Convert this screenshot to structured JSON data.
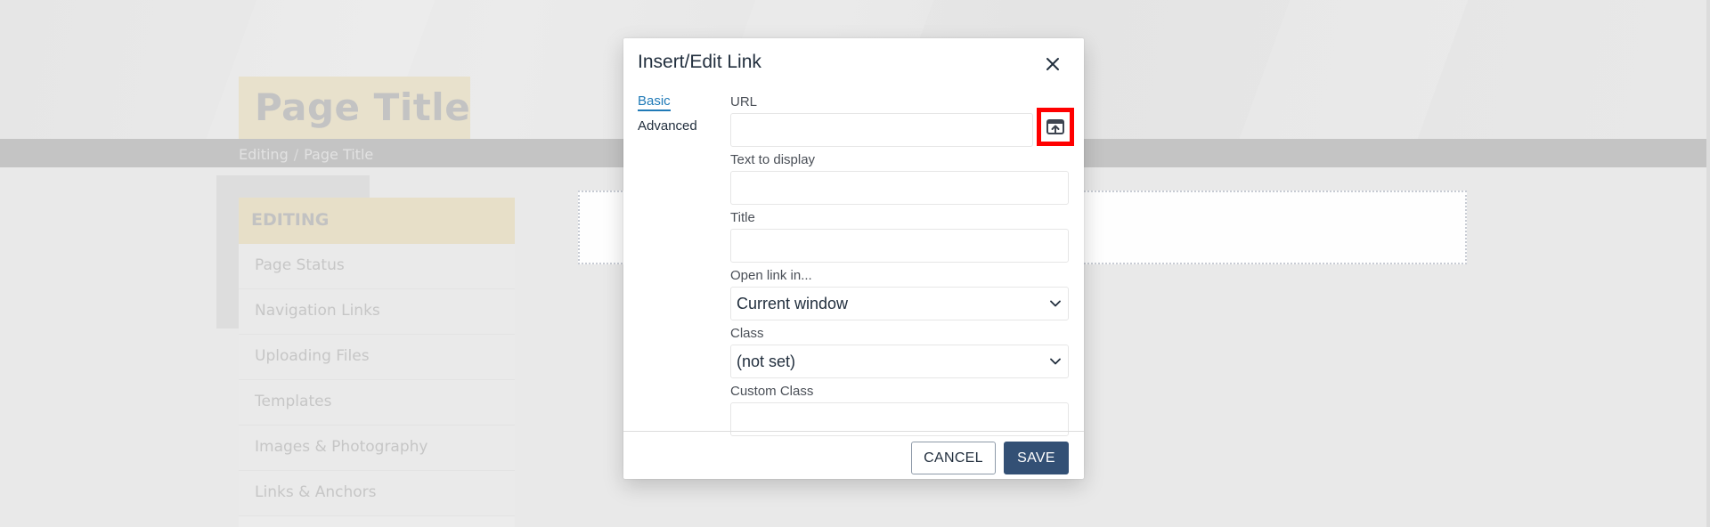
{
  "background_page": {
    "title": "Page Title",
    "breadcrumb": [
      "Editing",
      "Page Title"
    ],
    "breadcrumb_separator": "/",
    "sidebar": {
      "heading": "EDITING",
      "items": [
        {
          "label": "Page Status"
        },
        {
          "label": "Navigation Links"
        },
        {
          "label": "Uploading Files"
        },
        {
          "label": "Templates"
        },
        {
          "label": "Images & Photography"
        },
        {
          "label": "Links & Anchors"
        }
      ]
    }
  },
  "dialog": {
    "title": "Insert/Edit Link",
    "close_icon": "close-icon",
    "tabs": [
      {
        "label": "Basic",
        "active": true
      },
      {
        "label": "Advanced",
        "active": false
      }
    ],
    "fields": {
      "url": {
        "label": "URL",
        "value": "",
        "browse_icon": "browse-upload-icon"
      },
      "text_to_display": {
        "label": "Text to display",
        "value": ""
      },
      "title": {
        "label": "Title",
        "value": ""
      },
      "open_link_in": {
        "label": "Open link in...",
        "selected": "Current window"
      },
      "class": {
        "label": "Class",
        "selected": "(not set)"
      },
      "custom_class": {
        "label": "Custom Class",
        "value": ""
      }
    },
    "buttons": {
      "cancel": "CANCEL",
      "save": "SAVE"
    }
  },
  "colors": {
    "accent_link": "#207ab7",
    "primary_button": "#335075",
    "highlight_box": "#ff0000"
  }
}
